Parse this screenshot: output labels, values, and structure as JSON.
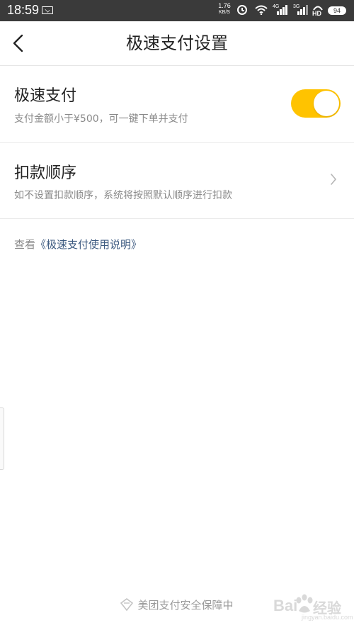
{
  "status_bar": {
    "time": "18:59",
    "net_speed_value": "1.76",
    "net_speed_unit": "KB/S",
    "signal1_tag": "4G",
    "signal2_tag": "3G",
    "hd_label": "HD",
    "battery_level": "94"
  },
  "header": {
    "title": "极速支付设置"
  },
  "rows": [
    {
      "title": "极速支付",
      "description": "支付金额小于¥500，可一键下单并支付",
      "toggle_on": true
    },
    {
      "title": "扣款顺序",
      "description": "如不设置扣款顺序，系统将按照默认顺序进行扣款"
    }
  ],
  "help": {
    "prefix": "查看",
    "link_text": "《极速支付使用说明》"
  },
  "footer": {
    "text": "美团支付安全保障中"
  },
  "watermark": {
    "left": "Bai",
    "right": "经验",
    "sub": "jingyan.baidu.com"
  },
  "colors": {
    "accent": "#ffc300",
    "link": "#3c5a80",
    "status_bar": "#3a3a3a"
  }
}
